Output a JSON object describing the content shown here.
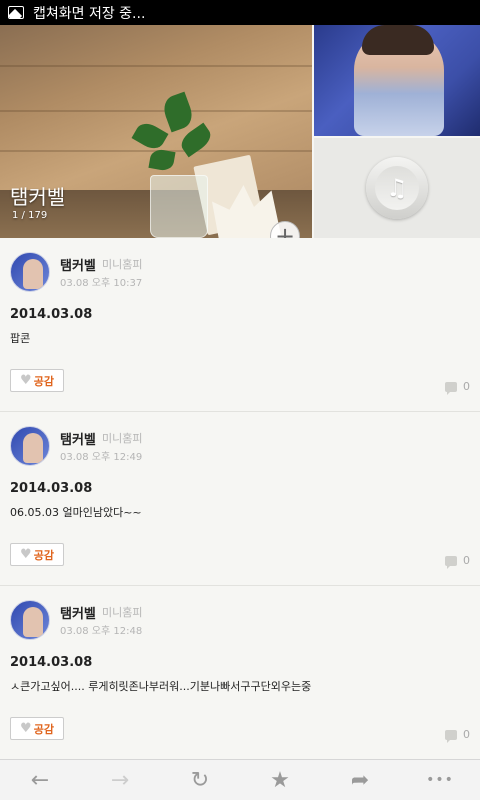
{
  "status_bar": {
    "notification_text": "캡쳐화면 저장 중..."
  },
  "header": {
    "cover_title": "탬커벨",
    "photo_counter": "1 / 179",
    "add_button_glyph": "+",
    "music_glyph": "♫"
  },
  "posts": [
    {
      "author": "탬커벨",
      "source": "미니홈피",
      "time": "03.08 오후 10:37",
      "date": "2014.03.08",
      "body": "팝콘",
      "like_label": "공감",
      "comment_count": "0"
    },
    {
      "author": "탬커벨",
      "source": "미니홈피",
      "time": "03.08 오후 12:49",
      "date": "2014.03.08",
      "body": "06.05.03 얼마인남았다~~",
      "like_label": "공감",
      "comment_count": "0"
    },
    {
      "author": "탬커벨",
      "source": "미니홈피",
      "time": "03.08 오후 12:48",
      "date": "2014.03.08",
      "body": "ㅅ큰가고싶어.... 루게히릿존나부러워...기분나빠서구구단외우는중",
      "like_label": "공감",
      "comment_count": "0"
    }
  ],
  "navbar": {
    "back": "←",
    "forward": "→",
    "refresh": "↻",
    "bookmark": "★",
    "share": "➦",
    "more": "•••"
  },
  "colors": {
    "like_accent": "#e0651e",
    "background": "#f6f6f3"
  }
}
